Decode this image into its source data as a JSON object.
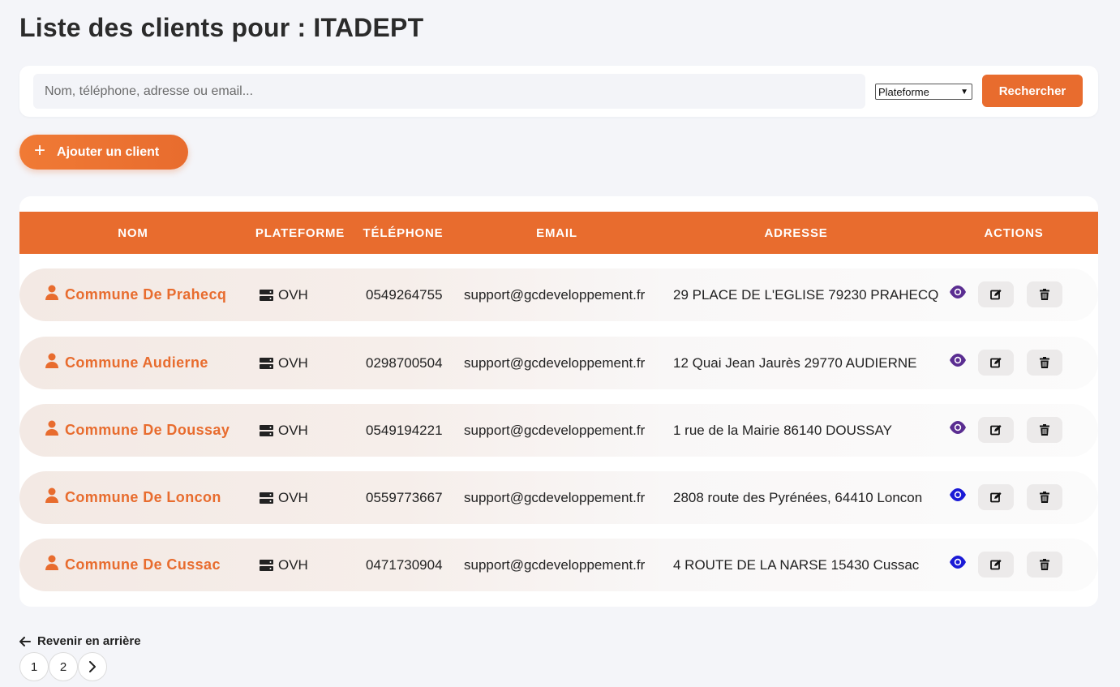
{
  "page": {
    "title": "Liste des clients pour : ITADEPT"
  },
  "search": {
    "placeholder": "Nom, téléphone, adresse ou email...",
    "value": "",
    "platform_selected": "Plateforme",
    "button_label": "Rechercher"
  },
  "add_button": {
    "label": "Ajouter un client"
  },
  "table": {
    "headers": [
      "NOM",
      "PLATEFORME",
      "TÉLÉPHONE",
      "EMAIL",
      "ADRESSE",
      "ACTIONS"
    ],
    "rows": [
      {
        "name": "Commune De Prahecq",
        "platform": "OVH",
        "phone": "0549264755",
        "email": "support@gcdeveloppement.fr",
        "address": "29 PLACE DE L'EGLISE 79230 PRAHECQ",
        "eye_color": "#5a2d91"
      },
      {
        "name": "Commune Audierne",
        "platform": "OVH",
        "phone": "0298700504",
        "email": "support@gcdeveloppement.fr",
        "address": "12 Quai Jean Jaurès 29770 AUDIERNE",
        "eye_color": "#5a2d91"
      },
      {
        "name": "Commune De Doussay",
        "platform": "OVH",
        "phone": "0549194221",
        "email": "support@gcdeveloppement.fr",
        "address": "1 rue de la Mairie 86140 DOUSSAY",
        "eye_color": "#5a2d91"
      },
      {
        "name": "Commune De Loncon",
        "platform": "OVH",
        "phone": "0559773667",
        "email": "support@gcdeveloppement.fr",
        "address": "2808 route des Pyrénées, 64410 Loncon",
        "eye_color": "#1a1ad6"
      },
      {
        "name": "Commune De Cussac",
        "platform": "OVH",
        "phone": "0471730904",
        "email": "support@gcdeveloppement.fr",
        "address": "4 ROUTE DE LA NARSE 15430 Cussac",
        "eye_color": "#1a1ad6"
      }
    ]
  },
  "footer": {
    "back_label": "Revenir en arrière",
    "pages": [
      "1",
      "2"
    ]
  },
  "colors": {
    "accent": "#e86c2e",
    "background": "#f4f5f9"
  }
}
